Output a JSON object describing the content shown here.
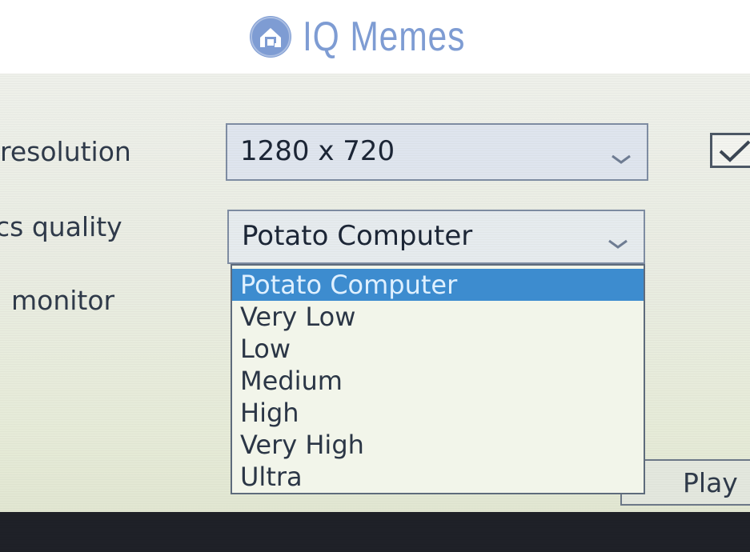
{
  "watermark": {
    "text": "IQ Memes",
    "color": "#7e9cd3",
    "icon": "house-logo-icon"
  },
  "settings": {
    "resolution": {
      "label": "resolution",
      "value": "1280 x 720"
    },
    "graphics_quality": {
      "label": "cs quality",
      "value": "Potato Computer",
      "options": [
        "Potato Computer",
        "Very Low",
        "Low",
        "Medium",
        "High",
        "Very High",
        "Ultra"
      ],
      "selected_index": 0,
      "highlight_color": "#3d8ccf"
    },
    "monitor": {
      "label": "monitor"
    },
    "fullscreen_checkbox": {
      "checked": true
    }
  },
  "actions": {
    "play_label": "Play"
  }
}
